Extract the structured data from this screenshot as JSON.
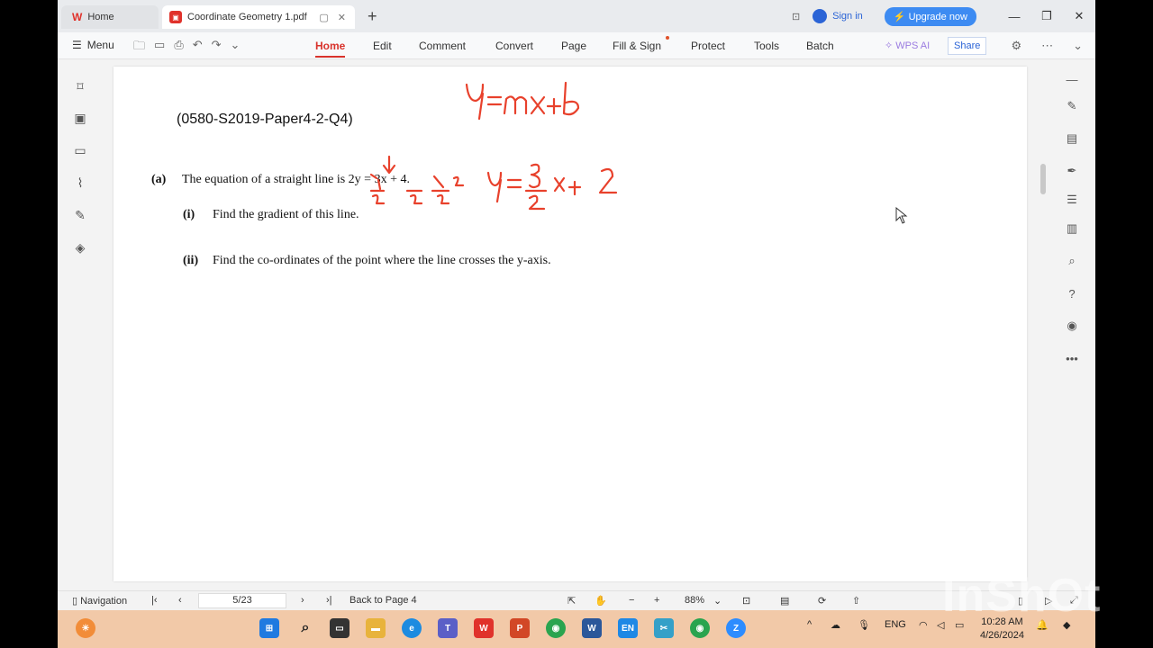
{
  "tabs": {
    "home_label": "Home",
    "doc_label": "Coordinate Geometry 1.pdf",
    "new_tab": "+"
  },
  "titlebar": {
    "sign_in": "Sign in",
    "upgrade": "Upgrade now",
    "minimize": "—",
    "restore": "❐",
    "close": "✕"
  },
  "ribbon": {
    "menu_label": "Menu",
    "tabs": [
      "Home",
      "Edit",
      "Comment",
      "Convert",
      "Page",
      "Fill & Sign",
      "Protect",
      "Tools",
      "Batch"
    ],
    "active_tab": "Home",
    "wps_ai": "WPS AI",
    "share": "Share"
  },
  "document": {
    "reference": "(0580-S2019-Paper4-2-Q4)",
    "part_a_label": "(a)",
    "part_a_text": "The equation of a straight line is 2y = 3x + 4.",
    "part_i_label": "(i)",
    "part_i_text": "Find the gradient of this line.",
    "part_ii_label": "(ii)",
    "part_ii_text": "Find the co-ordinates of the point where the line crosses the y-axis.",
    "annotation_top": "y=mx+b",
    "annotation_result": "y = 3/2 x + 2",
    "ink_color": "#e8412c"
  },
  "statusbar": {
    "navigation": "Navigation",
    "page_indicator": "5/23",
    "back_to_page": "Back to Page 4",
    "zoom": "88%"
  },
  "taskbar": {
    "language": "ENG",
    "time": "10:28 AM",
    "date": "4/26/2024"
  },
  "watermark": "InShOt"
}
